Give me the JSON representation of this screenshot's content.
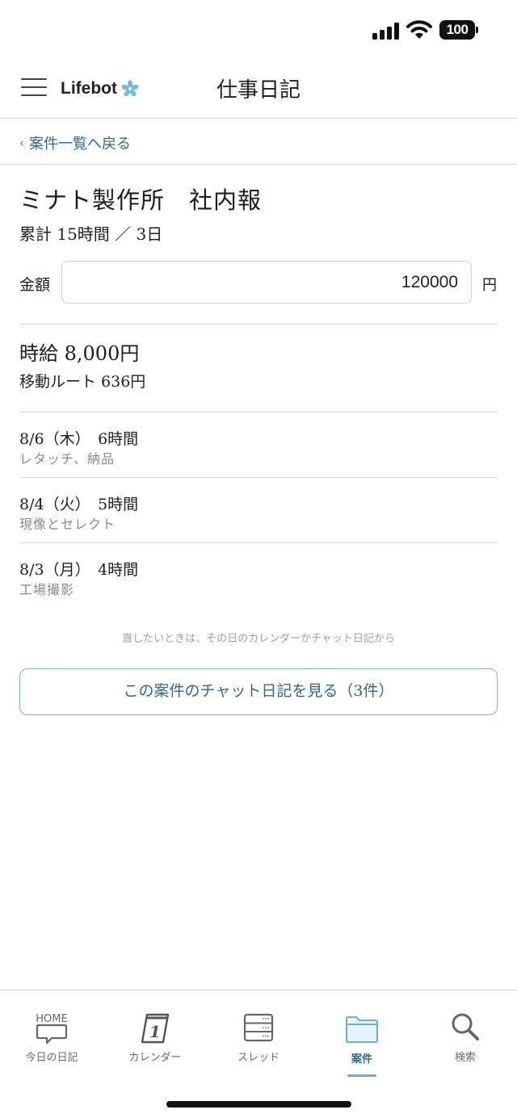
{
  "status_bar": {
    "battery": "100"
  },
  "header": {
    "brand": "Lifebot",
    "title": "仕事日記"
  },
  "nav": {
    "back_label": "案件一覧へ戻る"
  },
  "project": {
    "title": "ミナト製作所　社内報",
    "total": "累計 15時間 ／ 3日",
    "amount_label": "金額",
    "amount_value": "120000",
    "amount_unit": "円",
    "hourly_rate": "時給 8,000円",
    "travel": "移動ルート 636円"
  },
  "entries": [
    {
      "date_hours": "8/6（木）　6時間",
      "note": "レタッチ、納品"
    },
    {
      "date_hours": "8/4（火）　5時間",
      "note": "現像とセレクト"
    },
    {
      "date_hours": "8/3（月）　4時間",
      "note": "工場撮影"
    }
  ],
  "hint": "直したいときは、その日のカレンダーかチャット日記から",
  "chat_button": "この案件のチャット日記を見る（3件）",
  "tabs": [
    {
      "label": "今日の日記",
      "icon": "home-chat-icon",
      "icon_text": "HOME"
    },
    {
      "label": "カレンダー",
      "icon": "calendar-icon",
      "icon_text": "1"
    },
    {
      "label": "スレッド",
      "icon": "threads-icon"
    },
    {
      "label": "案件",
      "icon": "folder-icon",
      "active": true
    },
    {
      "label": "検索",
      "icon": "search-icon"
    }
  ],
  "colors": {
    "accent": "#2f6a86",
    "accent_light": "#6aaed0",
    "border": "#d9d9d9"
  }
}
